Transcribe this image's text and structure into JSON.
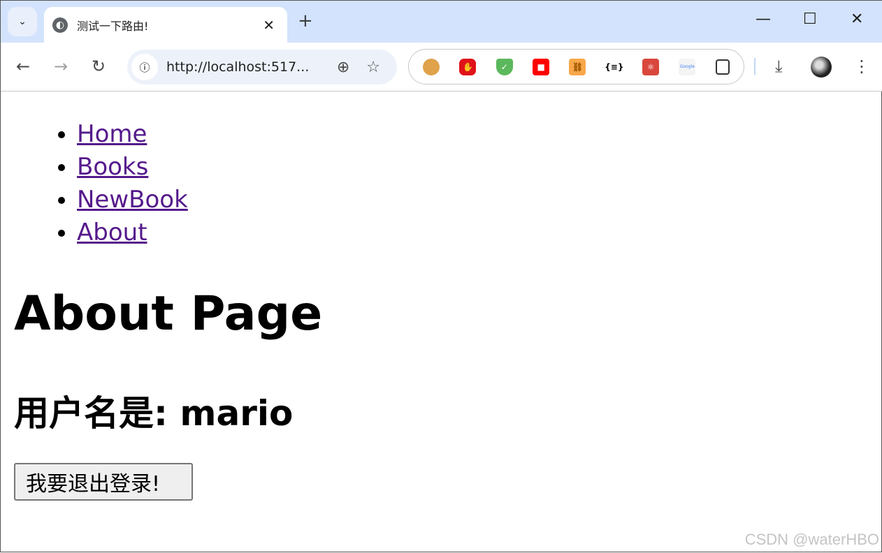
{
  "browser": {
    "tab_title": "测试一下路由!",
    "url": "http://localhost:517...",
    "extensions": [
      "cookie-icon",
      "adblock-icon",
      "shield-check-icon",
      "stop-icon",
      "link-icon",
      "json-formatter-icon",
      "react-devtools-icon",
      "google-translate-icon",
      "extensions-puzzle-icon"
    ],
    "google_label": "Google",
    "json_label": "{≡}"
  },
  "nav": {
    "items": [
      {
        "label": "Home"
      },
      {
        "label": "Books"
      },
      {
        "label": "NewBook"
      },
      {
        "label": "About"
      }
    ]
  },
  "page": {
    "title": "About Page",
    "username_line": "用户名是: mario",
    "logout_label": "我要退出登录!"
  },
  "watermark": "CSDN @waterHBO",
  "colors": {
    "link": "#551a8b",
    "tabbar": "#d3e3fd"
  }
}
